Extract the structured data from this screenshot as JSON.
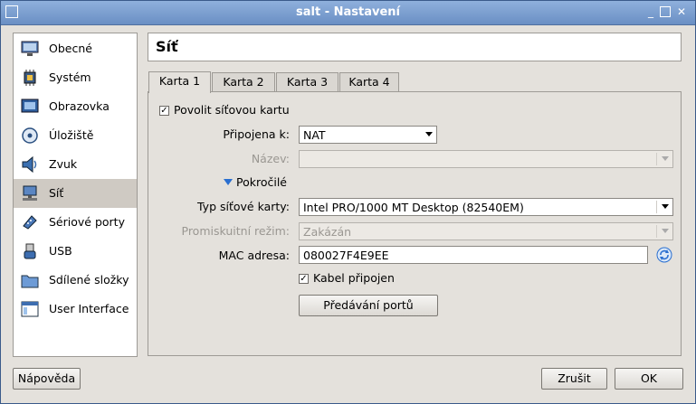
{
  "window": {
    "title": "salt - Nastavení"
  },
  "sidebar": {
    "items": [
      {
        "label": "Obecné",
        "icon": "monitor-icon",
        "selected": false
      },
      {
        "label": "Systém",
        "icon": "chip-icon",
        "selected": false
      },
      {
        "label": "Obrazovka",
        "icon": "display-icon",
        "selected": false
      },
      {
        "label": "Úložiště",
        "icon": "disk-icon",
        "selected": false
      },
      {
        "label": "Zvuk",
        "icon": "speaker-icon",
        "selected": false
      },
      {
        "label": "Síť",
        "icon": "network-icon",
        "selected": true
      },
      {
        "label": "Sériové porty",
        "icon": "serial-port-icon",
        "selected": false
      },
      {
        "label": "USB",
        "icon": "usb-icon",
        "selected": false
      },
      {
        "label": "Sdílené složky",
        "icon": "folder-icon",
        "selected": false
      },
      {
        "label": "User Interface",
        "icon": "window-icon",
        "selected": false
      }
    ]
  },
  "page": {
    "title": "Síť"
  },
  "tabs": [
    {
      "label": "Karta 1",
      "active": true
    },
    {
      "label": "Karta 2",
      "active": false
    },
    {
      "label": "Karta 3",
      "active": false
    },
    {
      "label": "Karta 4",
      "active": false
    }
  ],
  "adapter": {
    "enable_label": "Povolit síťovou kartu",
    "enabled": true,
    "attached_label": "Připojena k:",
    "attached_value": "NAT",
    "name_label": "Název:",
    "name_value": "",
    "advanced_label": "Pokročilé",
    "type_label": "Typ síťové karty:",
    "type_value": "Intel PRO/1000 MT Desktop (82540EM)",
    "promisc_label": "Promiskuitní režim:",
    "promisc_value": "Zakázán",
    "mac_label": "MAC adresa:",
    "mac_value": "080027F4E9EE",
    "cable_label": "Kabel připojen",
    "cable_connected": true,
    "port_forwarding_label": "Předávání portů"
  },
  "footer": {
    "help_label": "Nápověda",
    "cancel_label": "Zrušit",
    "ok_label": "OK"
  },
  "colors": {
    "titlebar": "#7a9cd0",
    "selection": "#cfcac3",
    "accent_blue": "#2a6fd0"
  }
}
